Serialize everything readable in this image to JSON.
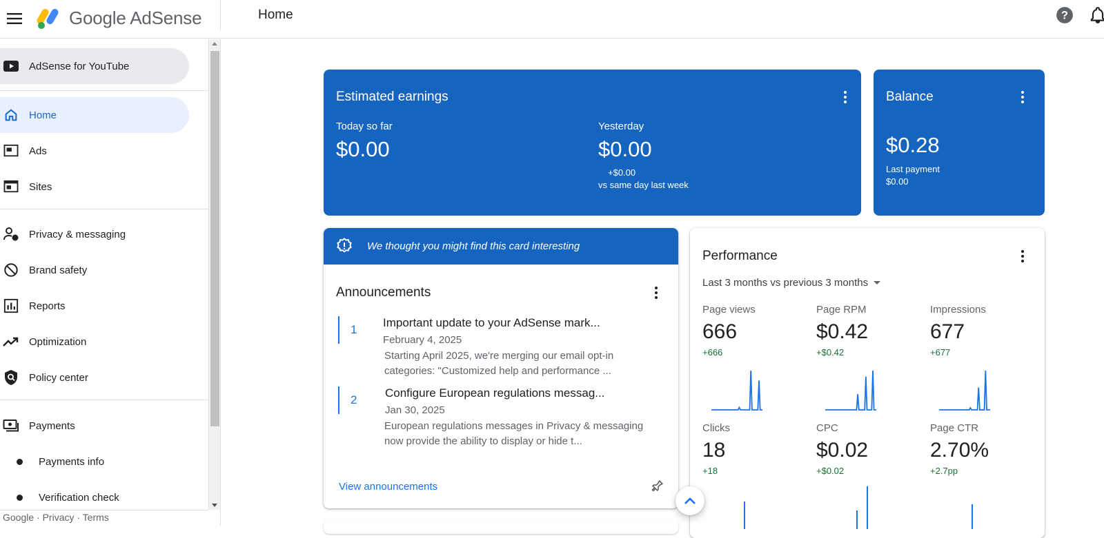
{
  "app": {
    "logo_google": "Google",
    "logo_adsense": "AdSense",
    "page_title": "Home"
  },
  "sidebar": {
    "items": [
      {
        "label": "AdSense for YouTube",
        "icon": "youtube-icon"
      },
      {
        "label": "Home",
        "icon": "home-icon"
      },
      {
        "label": "Ads",
        "icon": "ads-icon"
      },
      {
        "label": "Sites",
        "icon": "sites-icon"
      },
      {
        "label": "Privacy & messaging",
        "icon": "privacy-icon"
      },
      {
        "label": "Brand safety",
        "icon": "block-icon"
      },
      {
        "label": "Reports",
        "icon": "reports-icon"
      },
      {
        "label": "Optimization",
        "icon": "trending-up-icon"
      },
      {
        "label": "Policy center",
        "icon": "policy-shield-icon"
      },
      {
        "label": "Payments",
        "icon": "payments-icon"
      },
      {
        "label": "Payments info",
        "icon": "bullet-icon"
      },
      {
        "label": "Verification check",
        "icon": "bullet-icon"
      }
    ],
    "footer": "Google · Privacy · Terms"
  },
  "earnings": {
    "title": "Estimated earnings",
    "today_label": "Today so far",
    "today_value": "$0.00",
    "yesterday_label": "Yesterday",
    "yesterday_value": "$0.00",
    "yesterday_delta": "+$0.00",
    "yesterday_compare": "vs same day last week"
  },
  "balance": {
    "title": "Balance",
    "value": "$0.28",
    "last_payment_label": "Last payment",
    "last_payment_value": "$0.00"
  },
  "announcements": {
    "banner": "We thought you might find this card interesting",
    "title": "Announcements",
    "items": [
      {
        "num": "1",
        "headline": "Important update to your AdSense mark...",
        "date": "February 4, 2025",
        "body": "Starting April 2025, we're merging our email opt-in categories: \"Customized help and performance ..."
      },
      {
        "num": "2",
        "headline": "Configure European regulations messag...",
        "date": "Jan 30, 2025",
        "body": "European regulations messages in Privacy & messaging now provide the ability to display or hide t..."
      }
    ],
    "view_link": "View announcements"
  },
  "performance": {
    "title": "Performance",
    "range": "Last 3 months vs previous 3 months",
    "metrics": [
      {
        "label": "Page views",
        "value": "666",
        "delta": "+666",
        "spark": [
          0,
          0,
          0,
          0,
          0,
          0,
          0,
          0,
          0,
          0,
          0,
          0,
          0,
          0,
          0,
          0,
          0,
          0,
          0,
          0,
          0,
          0,
          0,
          0,
          0.06,
          0,
          0,
          0,
          0,
          0,
          0,
          0,
          0,
          0,
          1,
          0,
          0,
          0,
          0,
          0,
          0,
          0.75,
          0,
          0,
          0
        ]
      },
      {
        "label": "Page RPM",
        "value": "$0.42",
        "delta": "+$0.42",
        "spark": [
          0,
          0,
          0,
          0,
          0,
          0,
          0,
          0,
          0,
          0,
          0,
          0,
          0,
          0,
          0,
          0,
          0,
          0,
          0,
          0,
          0,
          0,
          0,
          0,
          0,
          0,
          0,
          0,
          0.4,
          0,
          0,
          0,
          0,
          0,
          0,
          0.85,
          0,
          0,
          0,
          0,
          0,
          1,
          0,
          0,
          0
        ]
      },
      {
        "label": "Impressions",
        "value": "677",
        "delta": "+677",
        "spark": [
          0,
          0,
          0,
          0,
          0,
          0,
          0,
          0,
          0,
          0,
          0,
          0,
          0,
          0,
          0,
          0,
          0,
          0,
          0,
          0,
          0,
          0,
          0,
          0,
          0,
          0,
          0,
          0.05,
          0,
          0,
          0,
          0,
          0,
          0,
          0.57,
          0,
          0,
          0,
          0,
          0,
          1,
          0,
          0,
          0,
          0
        ]
      },
      {
        "label": "Clicks",
        "value": "18",
        "delta": "+18"
      },
      {
        "label": "CPC",
        "value": "$0.02",
        "delta": "+$0.02"
      },
      {
        "label": "Page CTR",
        "value": "2.70%",
        "delta": "+2.7pp"
      }
    ]
  },
  "colors": {
    "brand_blue": "#1565c0",
    "link_blue": "#1a73e8",
    "positive_green": "#137333"
  }
}
